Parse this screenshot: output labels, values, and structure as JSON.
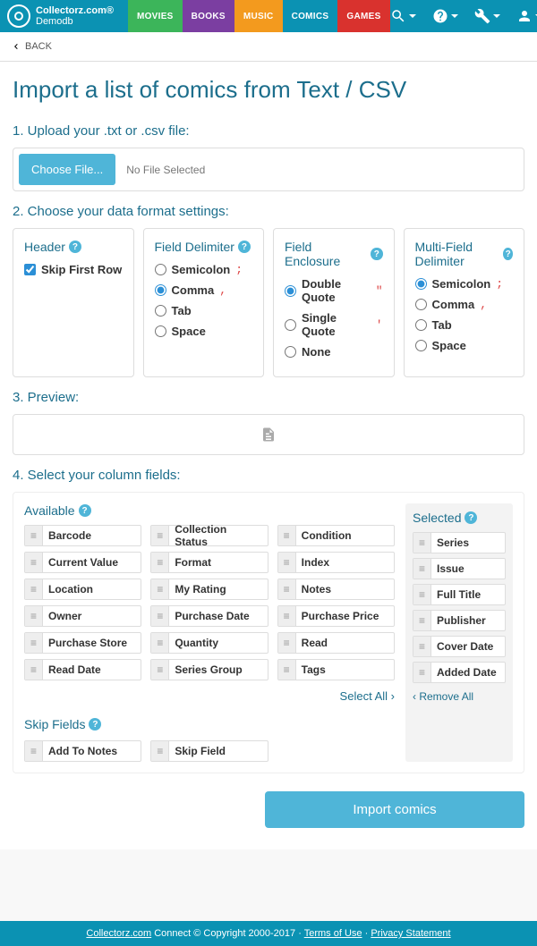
{
  "header": {
    "brand": "Collectorz.com®",
    "db": "Demodb",
    "tabs": [
      {
        "label": "MOVIES",
        "color": "#3cb55a"
      },
      {
        "label": "BOOKS",
        "color": "#7b3ea1"
      },
      {
        "label": "MUSIC",
        "color": "#f39a1e"
      },
      {
        "label": "COMICS",
        "color": "#0b92b3"
      },
      {
        "label": "GAMES",
        "color": "#d9322e"
      }
    ]
  },
  "back": "BACK",
  "title": "Import a list of comics from Text / CSV",
  "step1": {
    "heading": "1. Upload your .txt or .csv file:",
    "choose": "Choose File...",
    "nofile": "No File Selected"
  },
  "step2": {
    "heading": "2. Choose your data format settings:",
    "cards": {
      "header": {
        "title": "Header",
        "opts": [
          {
            "label": "Skip First Row",
            "type": "checkbox",
            "checked": true
          }
        ]
      },
      "fdelim": {
        "title": "Field Delimiter",
        "opts": [
          {
            "label": "Semicolon",
            "ch": ";",
            "type": "radio",
            "checked": false
          },
          {
            "label": "Comma",
            "ch": ",",
            "type": "radio",
            "checked": true
          },
          {
            "label": "Tab",
            "type": "radio",
            "checked": false
          },
          {
            "label": "Space",
            "type": "radio",
            "checked": false
          }
        ]
      },
      "fencl": {
        "title": "Field Enclosure",
        "opts": [
          {
            "label": "Double Quote",
            "ch": "\"",
            "type": "radio",
            "checked": true
          },
          {
            "label": "Single Quote",
            "ch": "'",
            "type": "radio",
            "checked": false
          },
          {
            "label": "None",
            "type": "radio",
            "checked": false
          }
        ]
      },
      "mdelim": {
        "title": "Multi-Field Delimiter",
        "opts": [
          {
            "label": "Semicolon",
            "ch": ";",
            "type": "radio",
            "checked": true
          },
          {
            "label": "Comma",
            "ch": ",",
            "type": "radio",
            "checked": false
          },
          {
            "label": "Tab",
            "type": "radio",
            "checked": false
          },
          {
            "label": "Space",
            "type": "radio",
            "checked": false
          }
        ]
      }
    }
  },
  "step3": {
    "heading": "3. Preview:"
  },
  "step4": {
    "heading": "4. Select your column fields:",
    "available_title": "Available",
    "available": [
      "Barcode",
      "Collection Status",
      "Condition",
      "Current Value",
      "Format",
      "Index",
      "Location",
      "My Rating",
      "Notes",
      "Owner",
      "Purchase Date",
      "Purchase Price",
      "Purchase Store",
      "Quantity",
      "Read",
      "Read Date",
      "Series Group",
      "Tags"
    ],
    "select_all": "Select All",
    "selected_title": "Selected",
    "selected": [
      "Series",
      "Issue",
      "Full Title",
      "Publisher",
      "Cover Date",
      "Added Date"
    ],
    "remove_all": "Remove All",
    "skip_title": "Skip Fields",
    "skip": [
      "Add To Notes",
      "Skip Field"
    ]
  },
  "submit": "Import comics",
  "footer": {
    "brand_link": "Collectorz.com",
    "copy": " Connect © Copyright 2000-2017 · ",
    "terms": "Terms of Use",
    "sep": " · ",
    "privacy": "Privacy Statement"
  }
}
